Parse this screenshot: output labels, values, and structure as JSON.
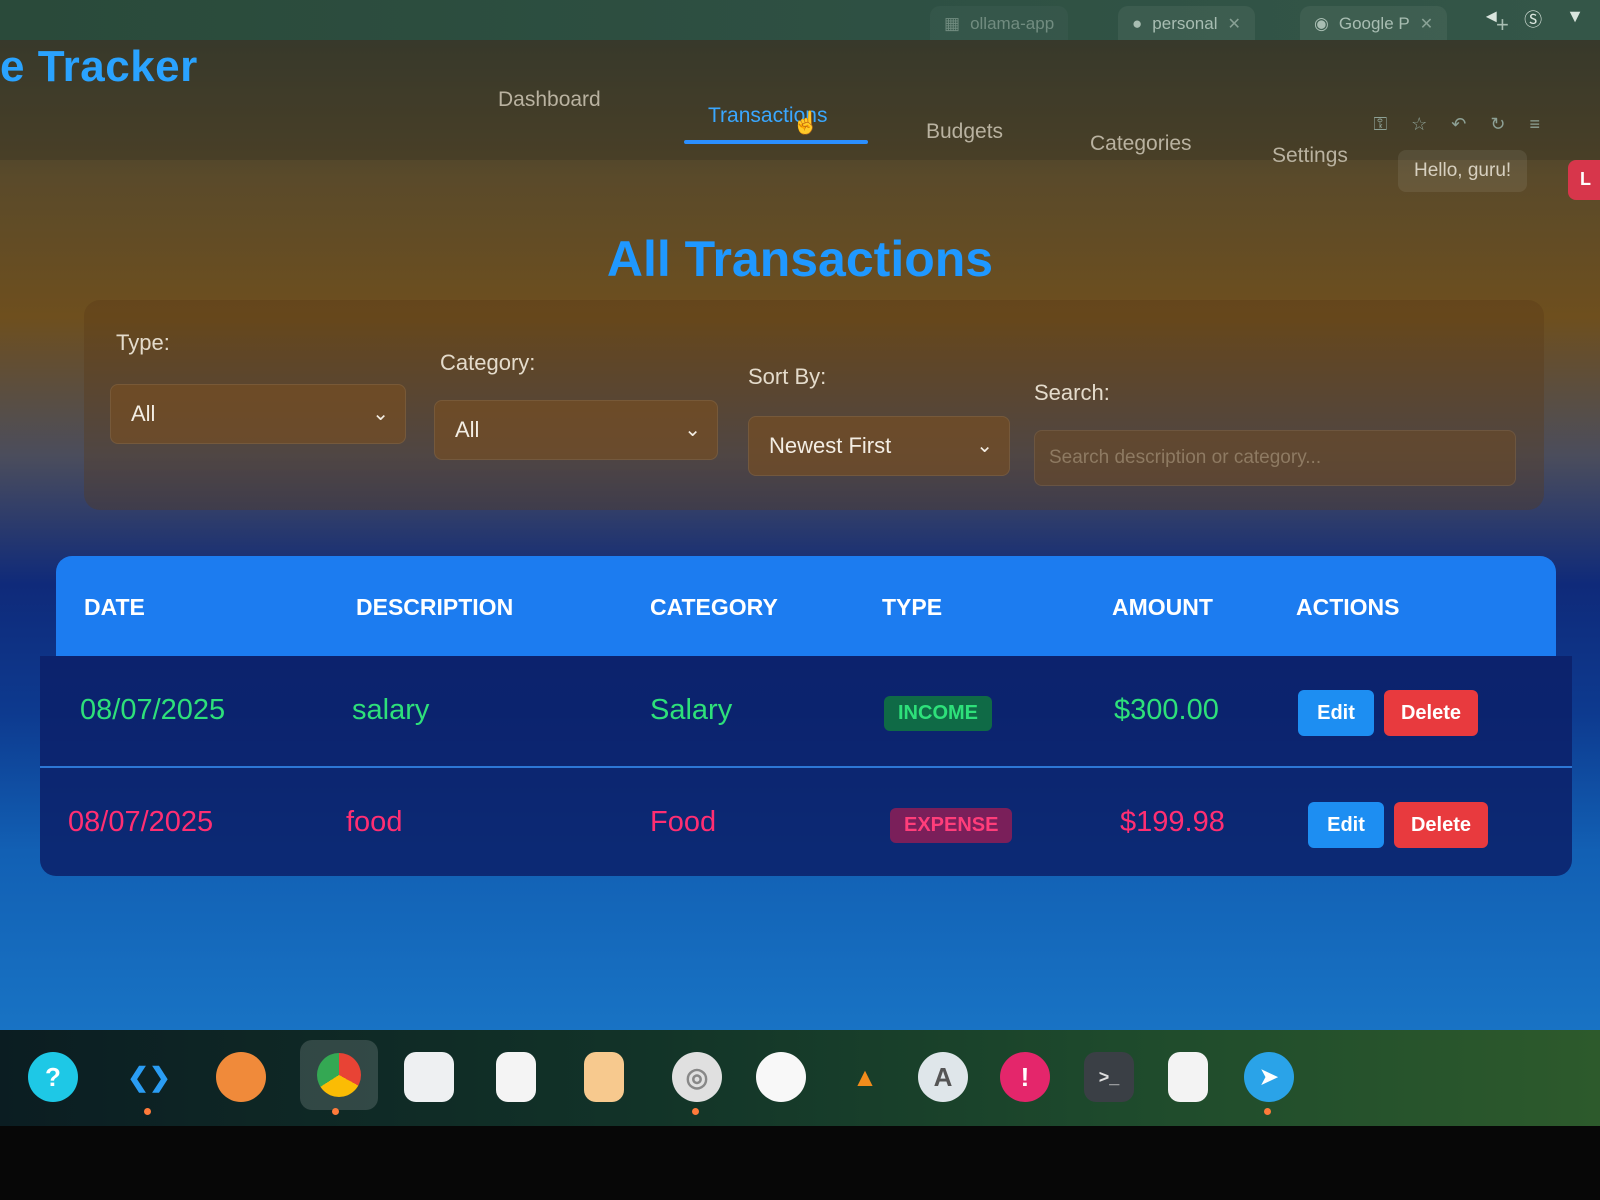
{
  "browser": {
    "tabs": [
      {
        "label": "ollama-app",
        "icon": "app-icon"
      },
      {
        "label": "personal",
        "icon": "github-icon"
      },
      {
        "label": "Google P",
        "icon": "chrome-icon"
      }
    ],
    "new_tab_label": "+",
    "tools": [
      "key-icon",
      "star-icon",
      "back-icon",
      "reload-icon",
      "menu-icon"
    ]
  },
  "app": {
    "brand": "e Tracker",
    "nav": [
      {
        "label": "Dashboard",
        "active": false
      },
      {
        "label": "Transactions",
        "active": true
      },
      {
        "label": "Budgets",
        "active": false
      },
      {
        "label": "Categories",
        "active": false
      },
      {
        "label": "Settings",
        "active": false
      }
    ],
    "greeting": "Hello, guru!",
    "logout_label": "L",
    "page_title": "All Transactions",
    "filters": {
      "type_label": "Type:",
      "type_value": "All",
      "category_label": "Category:",
      "category_value": "All",
      "sort_label": "Sort By:",
      "sort_value": "Newest First",
      "search_label": "Search:",
      "search_placeholder": "Search description or category..."
    },
    "table": {
      "headers": [
        "DATE",
        "DESCRIPTION",
        "CATEGORY",
        "TYPE",
        "AMOUNT",
        "ACTIONS"
      ],
      "rows": [
        {
          "date": "08/07/2025",
          "description": "salary",
          "category": "Salary",
          "type": "INCOME",
          "amount": "$300.00",
          "edit": "Edit",
          "delete": "Delete"
        },
        {
          "date": "08/07/2025",
          "description": "food",
          "category": "Food",
          "type": "EXPENSE",
          "amount": "$199.98",
          "edit": "Edit",
          "delete": "Delete"
        }
      ]
    }
  },
  "colors": {
    "accent": "#1f98ff",
    "income": "#2ee07a",
    "expense": "#ff2e72",
    "edit": "#1d8ef2",
    "delete": "#e83a3e"
  },
  "taskbar": {
    "apps": [
      "help-icon",
      "vscode-icon",
      "app-orange-icon",
      "chrome-icon",
      "files-icon",
      "text-editor-icon",
      "document-icon",
      "settings-icon",
      "white-circle-icon",
      "vlc-icon",
      "app-a-icon",
      "alert-icon",
      "terminal-icon",
      "notes-icon",
      "telegram-icon"
    ]
  }
}
